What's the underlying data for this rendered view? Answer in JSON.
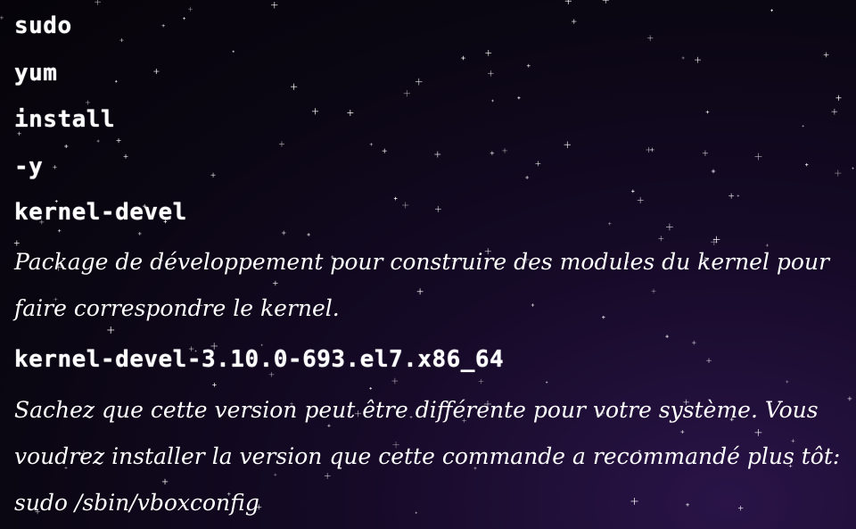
{
  "command_words": [
    "sudo",
    "yum",
    "install",
    "-y",
    "kernel-devel"
  ],
  "description_1": "Package de développement pour construire des modules du kernel pour faire correspondre le kernel.",
  "version": "kernel-devel-3.10.0-693.el7.x86_64",
  "description_2": "Sachez que cette version peut être différente pour votre système. Vous voudrez installer la version que cette commande a recommandé plus tôt: sudo /sbin/vboxconfig"
}
